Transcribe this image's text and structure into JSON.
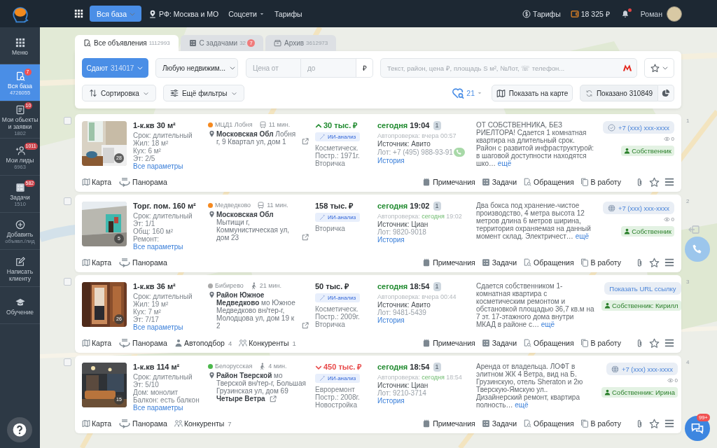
{
  "top_bar": {
    "nav_button": "Вся база",
    "region": "РФ: Москва и МО",
    "social": "Соцсети",
    "tariffs": "Тарифы",
    "tariffs_right": "Тарифы",
    "balance": "18 325 ₽",
    "notifications": {
      "unread": true
    },
    "user": "Роман"
  },
  "sidebar": {
    "items": [
      {
        "kind": "grid",
        "label": "Меню",
        "selected": false
      },
      {
        "kind": "searchdoc",
        "label": "Вся база",
        "badge": "7",
        "sub": "4726055",
        "selected": true
      },
      {
        "kind": "doc",
        "label": "Мои обьекты и заявки",
        "badge": "10",
        "sub": "1802",
        "selected": false
      },
      {
        "kind": "personadd",
        "label": "Мои лиды",
        "badge": "1011",
        "sub": "6963",
        "selected": false
      },
      {
        "kind": "tasks",
        "label": "Задачи",
        "badge": "582",
        "sub": "1510",
        "selected": false
      },
      {
        "kind": "plus",
        "label": "Добавить",
        "sub": "объявл./лид",
        "selected": false
      },
      {
        "kind": "edit",
        "label": "Написать клиенту",
        "selected": false
      },
      {
        "kind": "cap",
        "label": "Обучение",
        "selected": false
      }
    ]
  },
  "filters": {
    "tabs": [
      {
        "kind": "all",
        "label": "Все объявления",
        "count": "1112993",
        "selected": true
      },
      {
        "kind": "tasks",
        "label": "С задачами",
        "count": "32",
        "badge": "7",
        "selected": false
      },
      {
        "kind": "archive",
        "label": "Архив",
        "count": "3612973",
        "selected": false
      }
    ],
    "deal": {
      "label": "Сдают",
      "count": "314017"
    },
    "property": {
      "value": "Любую недвижим..."
    },
    "price_from": {
      "placeholder": "Цена от"
    },
    "price_to": {
      "placeholder": "до"
    },
    "currency": "₽",
    "search": {
      "placeholder": "Текст, район, цена ₽, площадь S м², №Лот, ☏ телефон..."
    },
    "sort": "Сортировка",
    "more_filters": "Ещё фильтры",
    "saved": {
      "count": "21"
    },
    "map_button": "Показать на карте",
    "shown": "Показано 310849"
  },
  "listings": [
    {
      "number": "1",
      "checked": false,
      "photo": {
        "kind": "picture",
        "count": "28"
      },
      "title": "1-к.кв 30 м²",
      "params": [
        "Срок: длительный",
        "Жил: 18 м²",
        "Кух: 6 м²",
        "Эт: 2/5"
      ],
      "params_link": "Все параметры",
      "metro": {
        "name": "МЦД1 Лобня",
        "color": "#f5891f"
      },
      "travel": {
        "kind": "bus",
        "time": "11 мин."
      },
      "region": "Московская Обл",
      "address": "Лобня г, 9 Квартал ул, дом 1",
      "price": "30 тыс. ₽",
      "price_up": true,
      "price_down": false,
      "ai": "ИИ-анализ",
      "details": [
        "Косметическ.",
        "Постр.: 1971г.",
        "Вторичка"
      ],
      "date": "сегодня",
      "time": "19:04",
      "repeats": "1",
      "autocheck": {
        "label": "Автопроверка:",
        "day": "вчера",
        "recent": false,
        "time": "00:57"
      },
      "source": "Источник: Авито",
      "lot": "Лот: +7 (495) 988-93-91",
      "lot_call": true,
      "history": "История",
      "description": "ОТ СОБСТВЕННИКА, БЕЗ РИЕЛТОРА! Сдается 1 комнатная квартира на длительный срок. Район с развитой инфраструктурой: в шаговой доступности находятся шко…",
      "more": "ещё",
      "contact": {
        "kind": "verified",
        "text": "+7 (xxx) xxx-xxxx"
      },
      "views": "0",
      "owner": "Собственник",
      "links": [
        {
          "kind": "map",
          "label": "Карта"
        },
        {
          "kind": "panorama",
          "label": "Панорама"
        }
      ],
      "actions": [
        {
          "kind": "notes",
          "label": "Примечания"
        },
        {
          "kind": "tasks",
          "label": "Задачи"
        },
        {
          "kind": "requests",
          "label": "Обращения"
        },
        {
          "kind": "work",
          "label": "В работу"
        }
      ]
    },
    {
      "number": "2",
      "checked": false,
      "photo": {
        "kind": "picture",
        "count": "5"
      },
      "title": "Торг. пом. 160 м²",
      "params": [
        "Срок: длительный",
        "Эт: 1/1",
        "Общ: 160 м²",
        "Ремонт:"
      ],
      "params_link": "Все параметры",
      "metro": {
        "name": "Медведково",
        "color": "#f5891f"
      },
      "travel": {
        "kind": "bus",
        "time": "11 мин."
      },
      "region": "Московская Обл",
      "address": "Мытищи г, Коммунистическая ул, дом 23",
      "price": "158 тыс. ₽",
      "price_up": false,
      "price_down": false,
      "ai": "ИИ-анализ",
      "details": [
        "Вторичка"
      ],
      "date": "сегодня",
      "time": "19:02",
      "repeats": "1",
      "autocheck": {
        "label": "Автопроверка:",
        "day": "сегодня",
        "recent": true,
        "time": "19:02"
      },
      "source": "Источник: Циан",
      "lot": "Лот: 9820-9018",
      "lot_call": false,
      "history": "История",
      "description": "Два бокса под хранение-чистое производство, 4 метра высота 12 метров длина 6 метров ширина, территория охраняемая на данный момент склад. Электричест…",
      "more": "ещё",
      "contact": {
        "kind": "web",
        "text": "+7 (xxx) xxx-xxxx"
      },
      "views": "0",
      "owner": "Собственник",
      "links": [
        {
          "kind": "map",
          "label": "Карта"
        },
        {
          "kind": "panorama",
          "label": "Панорама"
        }
      ],
      "actions": [
        {
          "kind": "notes",
          "label": "Примечания"
        },
        {
          "kind": "tasks",
          "label": "Задачи"
        },
        {
          "kind": "requests",
          "label": "Обращения"
        },
        {
          "kind": "work",
          "label": "В работу"
        }
      ]
    },
    {
      "number": "3",
      "checked": false,
      "photo": {
        "kind": "picture",
        "count": "26"
      },
      "title": "1-к.кв 36 м²",
      "params": [
        "Срок: длительный",
        "Жил: 19 м²",
        "Кух: 7 м²",
        "Эт: 7/17"
      ],
      "params_link": "Все параметры",
      "metro": {
        "name": "Бибирево",
        "color": "#a9a9a9"
      },
      "travel": {
        "kind": "walk",
        "time": "21 мин."
      },
      "region": "Район Южное Медведково",
      "address": "мо Южное Медведково вн/тер-г, Молодцова ул, дом 19 к 2",
      "price": "50 тыс. ₽",
      "price_up": false,
      "price_down": false,
      "ai": "ИИ-анализ",
      "details": [
        "Косметическ.",
        "Постр.: 2009г.",
        "Вторичка"
      ],
      "date": "сегодня",
      "time": "18:54",
      "repeats": "1",
      "autocheck": {
        "label": "Автопроверка:",
        "day": "вчера",
        "recent": false,
        "time": "00:44"
      },
      "source": "Источник: Авито",
      "lot": "Лот: 9481-5439",
      "lot_call": false,
      "history": "История",
      "description": "Сдается собственником 1-комнатная квартира с косметическим ремонтом и обстановкой площадью 36,7 кв.м на 7 эт. 17-этажного дома внутри МКАД в районе с…",
      "more": "ещё",
      "contact": {
        "kind": "url",
        "text": "Показать URL ссылку"
      },
      "owner": "Собственник: Кирилл",
      "links": [
        {
          "kind": "map",
          "label": "Карта"
        },
        {
          "kind": "panorama",
          "label": "Панорама"
        },
        {
          "kind": "autoselect",
          "label": "Автоподбор",
          "count": "4"
        },
        {
          "kind": "competitors",
          "label": "Конкуренты",
          "count": "1"
        }
      ],
      "actions": [
        {
          "kind": "notes",
          "label": "Примечания"
        },
        {
          "kind": "tasks",
          "label": "Задачи"
        },
        {
          "kind": "requests",
          "label": "Обращения"
        },
        {
          "kind": "work",
          "label": "В работу"
        }
      ]
    },
    {
      "number": "4",
      "checked": false,
      "photo": {
        "kind": "picture",
        "count": "15"
      },
      "title": "1-к.кв 114 м²",
      "params": [
        "Срок: длительный",
        "Эт: 5/10",
        "Дом: монолит",
        "Балкон: есть балкон"
      ],
      "params_link": "Все параметры",
      "metro": {
        "name": "Белорусская",
        "color": "#4cb84c"
      },
      "travel": {
        "kind": "walk",
        "time": "4 мин."
      },
      "region": "Район Тверской",
      "address": "мо Тверской вн/тер-г, Большая Грузинская ул, дом 69",
      "complex": "Четыре Ветра",
      "price": "450 тыс. ₽",
      "price_up": false,
      "price_down": true,
      "ai": "ИИ-анализ",
      "details": [
        "Евроремонт",
        "Постр.: 2008г.",
        "Новостройка"
      ],
      "date": "сегодня",
      "time": "18:54",
      "repeats": "1",
      "autocheck": {
        "label": "Автопроверка:",
        "day": "сегодня",
        "recent": true,
        "time": "18:54"
      },
      "source": "Источник: Циан",
      "lot": "Лот: 9210-3714",
      "lot_call": false,
      "history": "История",
      "description": "Аренда от владельца. ЛОФТ в элитном ЖК 4 Ветра, вид на Б. Грузинскую, отель Sheraton и 2ю Тверскую-Ямскую ул.. Дизайнерский ремонт, квартира полность…",
      "more": "ещё",
      "contact": {
        "kind": "web",
        "text": "+7 (xxx) xxx-xxxx"
      },
      "views": "0",
      "owner": "Собственник: Ирина",
      "links": [
        {
          "kind": "map",
          "label": "Карта"
        },
        {
          "kind": "panorama",
          "label": "Панорама"
        },
        {
          "kind": "competitors",
          "label": "Конкуренты",
          "count": "7"
        }
      ],
      "actions": [
        {
          "kind": "notes",
          "label": "Примечания"
        },
        {
          "kind": "tasks",
          "label": "Задачи"
        },
        {
          "kind": "requests",
          "label": "Обращения"
        },
        {
          "kind": "work",
          "label": "В работу"
        }
      ]
    }
  ],
  "widgets": {
    "chat_badge": "99+"
  }
}
